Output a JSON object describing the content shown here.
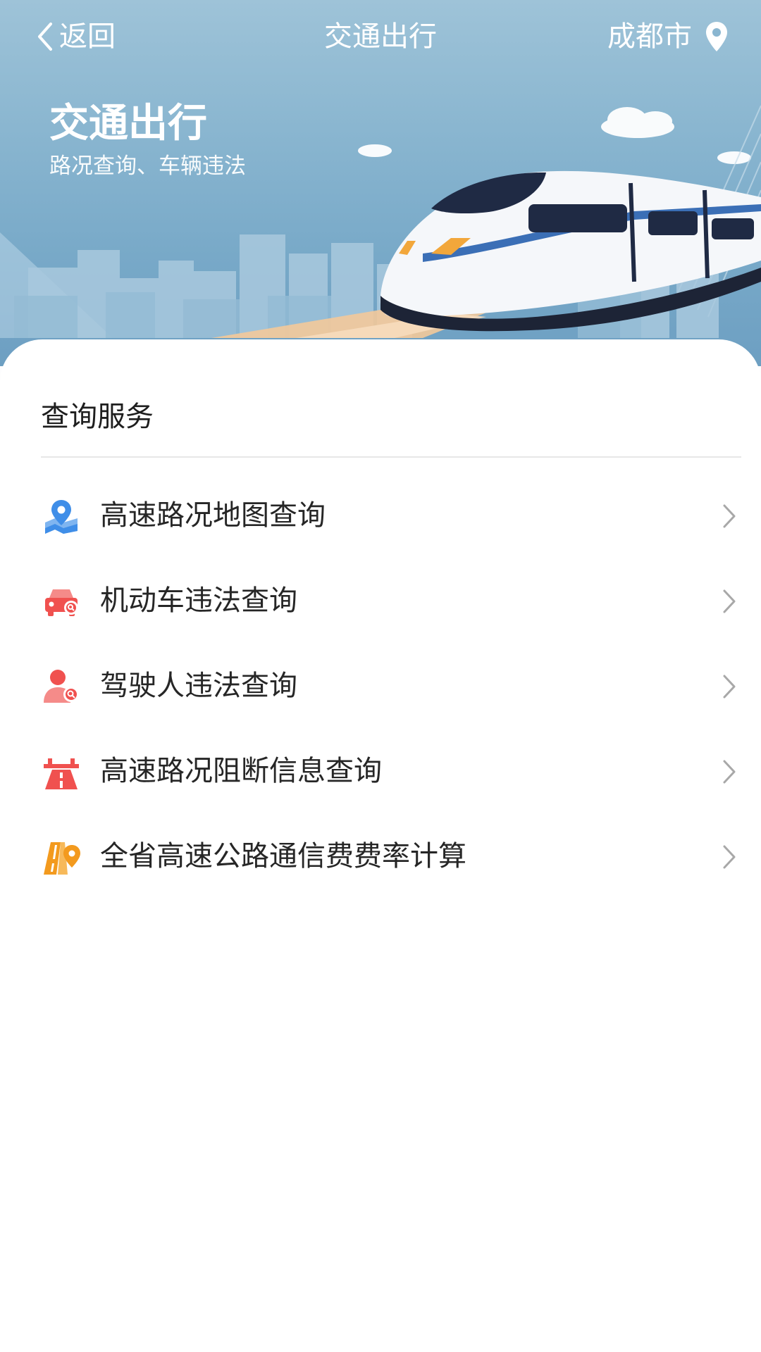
{
  "nav": {
    "back_label": "返回",
    "title": "交通出行",
    "city": "成都市"
  },
  "hero": {
    "title": "交通出行",
    "subtitle": "路况查询、车辆违法"
  },
  "section": {
    "title": "查询服务"
  },
  "services": [
    {
      "label": "高速路况地图查询",
      "icon": "map-location-icon",
      "color": "#3f8ee8"
    },
    {
      "label": "机动车违法查询",
      "icon": "car-search-icon",
      "color": "#f0514f"
    },
    {
      "label": "驾驶人违法查询",
      "icon": "driver-search-icon",
      "color": "#f0514f"
    },
    {
      "label": "高速路况阻断信息查询",
      "icon": "highway-blocked-icon",
      "color": "#f0514f"
    },
    {
      "label": "全省高速公路通信费费率计算",
      "icon": "road-toll-icon",
      "color": "#f39a1e"
    }
  ],
  "colors": {
    "hero_sky": "#8ab6d0",
    "text_primary": "#262626",
    "arrow": "#a8a8a8"
  }
}
